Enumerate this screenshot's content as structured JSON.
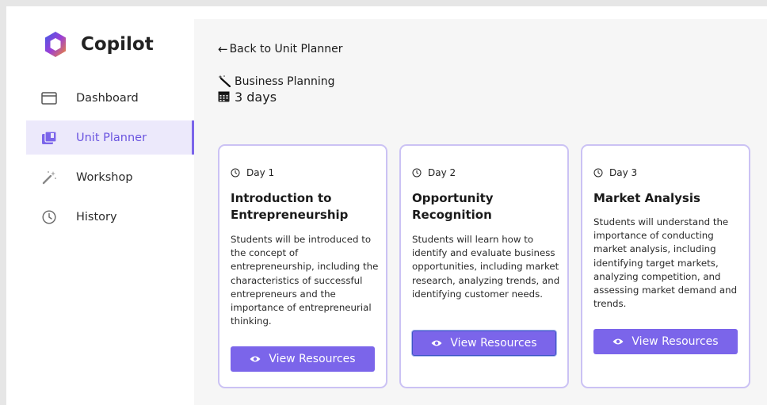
{
  "app": {
    "name": "Copilot"
  },
  "sidebar": {
    "items": [
      {
        "label": "Dashboard",
        "icon": "dashboard-icon",
        "active": false
      },
      {
        "label": "Unit Planner",
        "icon": "unit-planner-icon",
        "active": true
      },
      {
        "label": "Workshop",
        "icon": "magic-wand-icon",
        "active": false
      },
      {
        "label": "History",
        "icon": "clock-icon",
        "active": false
      }
    ]
  },
  "header": {
    "back_label": "Back to Unit Planner",
    "topic": "Business Planning",
    "duration": "3 days"
  },
  "cards": [
    {
      "day": "Day 1",
      "title": "Introduction to Entrepreneurship",
      "description": "Students will be introduced to the concept of entrepreneurship, including the characteristics of successful entrepreneurs and the importance of entrepreneurial thinking.",
      "button_label": "View Resources"
    },
    {
      "day": "Day 2",
      "title": "Opportunity Recognition",
      "description": "Students will learn how to identify and evaluate business opportunities, including market research, analyzing trends, and identifying customer needs.",
      "button_label": "View Resources"
    },
    {
      "day": "Day 3",
      "title": "Market Analysis",
      "description": "Students will understand the importance of conducting market analysis, including identifying target markets, analyzing competition, and assessing market demand and trends.",
      "button_label": "View Resources"
    }
  ],
  "colors": {
    "accent": "#7b65ea",
    "active_bg": "#ece9fb",
    "card_border": "#cbc2f4"
  }
}
